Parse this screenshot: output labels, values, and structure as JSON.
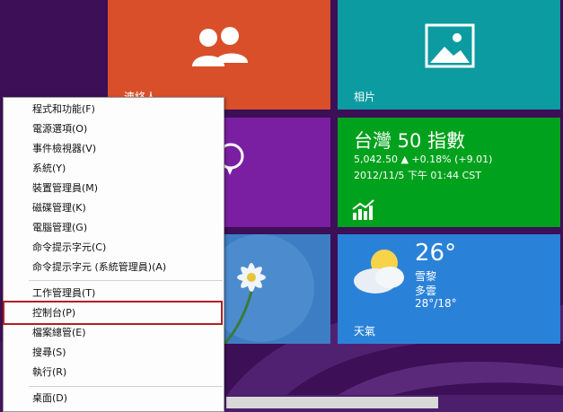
{
  "tiles": {
    "people": {
      "label": "連絡人",
      "icon": "people-icon",
      "color": "#d94f2a"
    },
    "photos": {
      "label": "相片",
      "icon": "photo-icon",
      "color": "#0c9ba1"
    },
    "messaging": {
      "icon": "messaging-icon",
      "color": "#7a1fa2"
    },
    "finance": {
      "title": "台灣 50 指數",
      "change": "5,042.50 ▲ +0.18% (+9.01)",
      "time": "2012/11/5 下午 01:44 CST",
      "icon": "stock-chart-icon",
      "color": "#00a11c"
    },
    "desktop": {
      "icon": "flower-image",
      "color": "#3570b8"
    },
    "weather": {
      "temp": "26°",
      "cond1": "雪黎",
      "cond2": "多雲",
      "range": "28°/18°",
      "label": "天氣",
      "icon": "cloud-sun-icon",
      "color": "#2a82d8"
    }
  },
  "menu": {
    "items": [
      {
        "label": "程式和功能(F)"
      },
      {
        "label": "電源選項(O)"
      },
      {
        "label": "事件檢視器(V)"
      },
      {
        "label": "系統(Y)"
      },
      {
        "label": "裝置管理員(M)"
      },
      {
        "label": "磁碟管理(K)"
      },
      {
        "label": "電腦管理(G)"
      },
      {
        "label": "命令提示字元(C)"
      },
      {
        "label": "命令提示字元 (系統管理員)(A)"
      },
      {
        "label": "工作管理員(T)"
      },
      {
        "label": "控制台(P)"
      },
      {
        "label": "檔案總管(E)"
      },
      {
        "label": "搜尋(S)"
      },
      {
        "label": "執行(R)"
      },
      {
        "label": "桌面(D)"
      }
    ]
  }
}
